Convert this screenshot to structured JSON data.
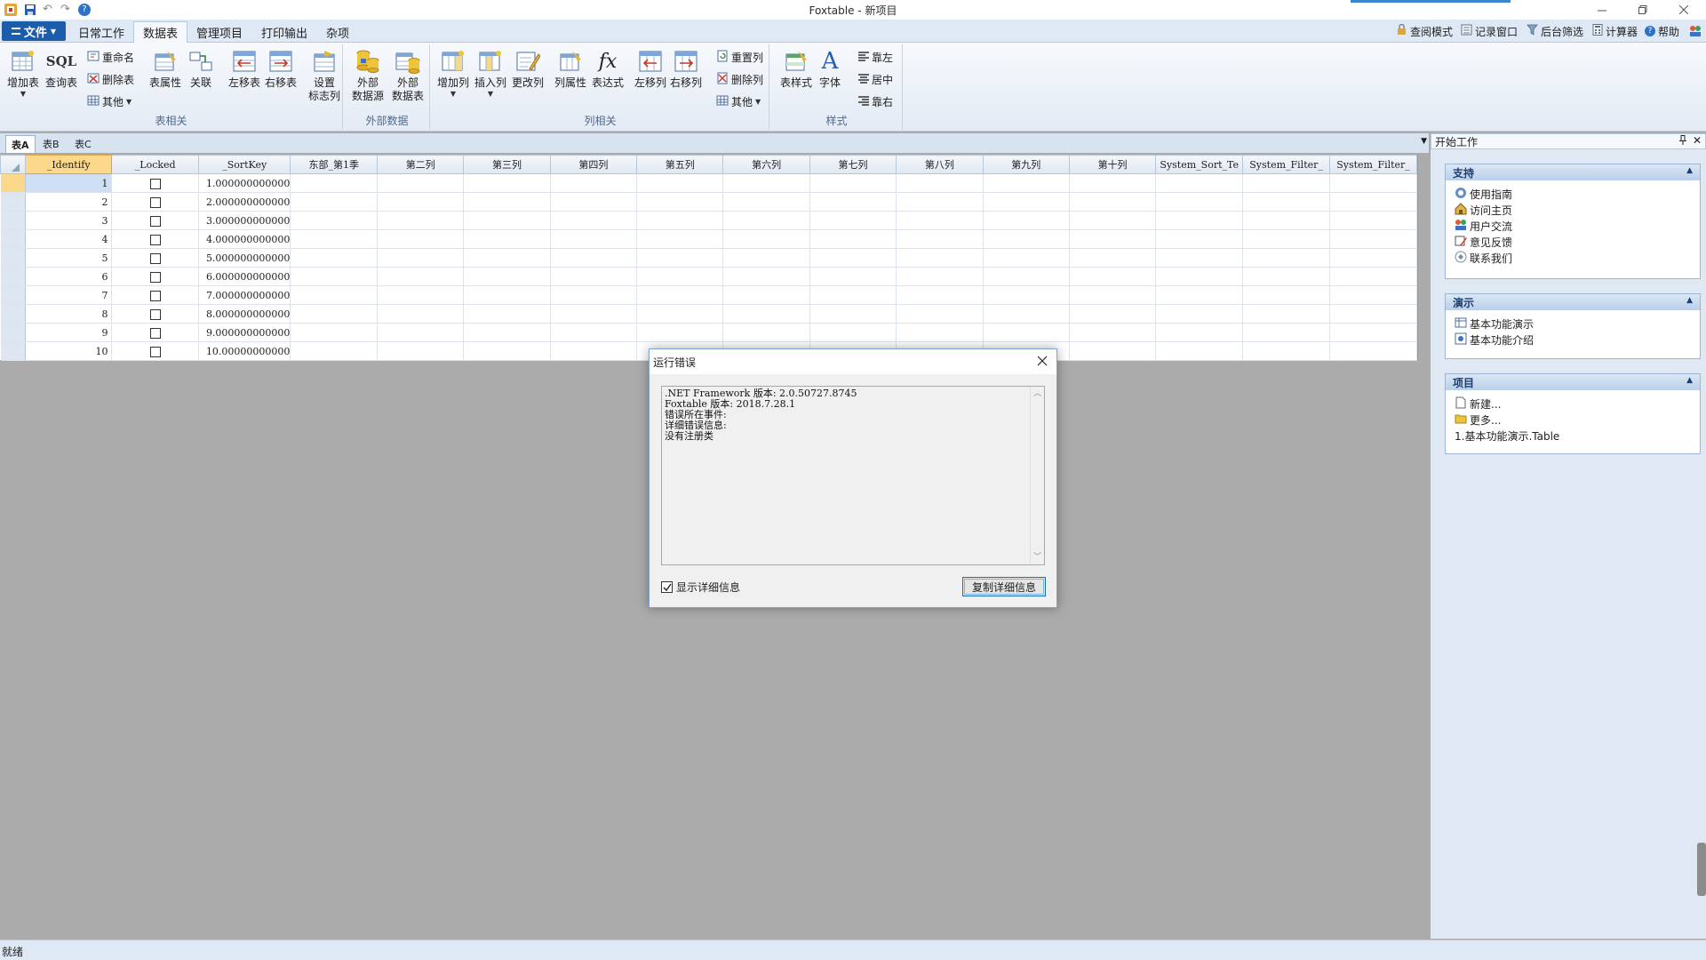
{
  "window": {
    "title": "Foxtable - 新项目"
  },
  "menu": {
    "file_label": "文件",
    "tabs": [
      "日常工作",
      "数据表",
      "管理项目",
      "打印输出",
      "杂项"
    ],
    "active_tab": "数据表",
    "right": [
      "查阅模式",
      "记录窗口",
      "后台筛选",
      "计算器",
      "帮助"
    ]
  },
  "ribbon": {
    "table_group": {
      "label": "表相关",
      "add_table": "增加表",
      "sql_icon_text": "SQL",
      "query_table": "查询表",
      "rename": "重命名",
      "delete_table": "删除表",
      "other": "其他",
      "table_props": "表属性",
      "relation": "关联",
      "move_left": "左移表",
      "move_right": "右移表",
      "flag_col_1": "设置",
      "flag_col_2": "标志列"
    },
    "external_group": {
      "label": "外部数据",
      "src_1": "外部",
      "src_2": "数据源",
      "tbl_1": "外部",
      "tbl_2": "数据表"
    },
    "column_group": {
      "label": "列相关",
      "add_col": "增加列",
      "insert_col": "插入列",
      "change_col": "更改列",
      "col_props": "列属性",
      "fx_icon_text": "fx",
      "expression": "表达式",
      "col_left": "左移列",
      "col_right": "右移列",
      "reset_col": "重置列",
      "delete_col": "删除列",
      "other": "其他"
    },
    "style_group": {
      "label": "样式",
      "table_style": "表样式",
      "font_icon_text": "A",
      "font": "字体",
      "align_left": "靠左",
      "align_center": "居中",
      "align_right": "靠右"
    }
  },
  "sheet_tabs": [
    "表A",
    "表B",
    "表C"
  ],
  "grid": {
    "columns": [
      "_Identify",
      "_Locked",
      "_SortKey",
      "东部_第1季",
      "第二列",
      "第三列",
      "第四列",
      "第五列",
      "第六列",
      "第七列",
      "第八列",
      "第九列",
      "第十列",
      "System_Sort_Te",
      "System_Filter_",
      "System_Filter_"
    ],
    "rows": [
      {
        "id": "1",
        "sortkey": "1.000000000000"
      },
      {
        "id": "2",
        "sortkey": "2.000000000000"
      },
      {
        "id": "3",
        "sortkey": "3.000000000000"
      },
      {
        "id": "4",
        "sortkey": "4.000000000000"
      },
      {
        "id": "5",
        "sortkey": "5.000000000000"
      },
      {
        "id": "6",
        "sortkey": "6.000000000000"
      },
      {
        "id": "7",
        "sortkey": "7.000000000000"
      },
      {
        "id": "8",
        "sortkey": "8.000000000000"
      },
      {
        "id": "9",
        "sortkey": "9.000000000000"
      },
      {
        "id": "10",
        "sortkey": "10.00000000000"
      }
    ]
  },
  "dialog": {
    "title": "运行错误",
    "lines": [
      ".NET Framework 版本: 2.0.50727.8745",
      "Foxtable 版本: 2018.7.28.1",
      "错误所在事件:",
      "详细错误信息:",
      "没有注册类"
    ],
    "show_details": "显示详细信息",
    "copy_button": "复制详细信息"
  },
  "right_panel": {
    "title": "开始工作",
    "sections": [
      {
        "title": "支持",
        "items": [
          "使用指南",
          "访问主页",
          "用户交流",
          "意见反馈",
          "联系我们"
        ]
      },
      {
        "title": "演示",
        "items": [
          "基本功能演示",
          "基本功能介绍"
        ]
      },
      {
        "title": "项目",
        "items": [
          "新建...",
          "更多...",
          "1.基本功能演示.Table"
        ]
      }
    ]
  },
  "status": {
    "text": "就绪"
  },
  "colors": {
    "accent": "#1c5dab",
    "selected_header": "#fbd88c",
    "ribbon_bg": "#dfe9f5",
    "workspace": "#ababab"
  }
}
